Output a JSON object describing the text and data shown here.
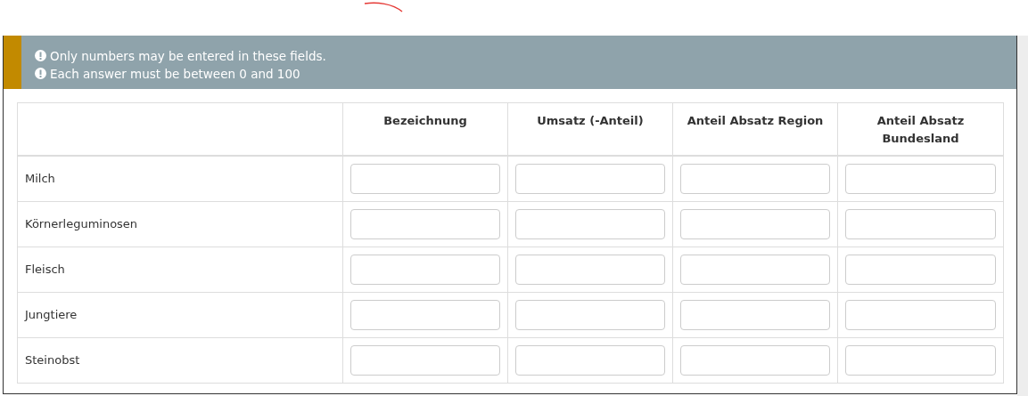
{
  "notices": [
    "Only numbers may be entered in these fields.",
    "Each answer must be between 0 and 100"
  ],
  "table": {
    "columns": [
      "",
      "Bezeichnung",
      "Umsatz (-Anteil)",
      "Anteil Absatz Region",
      "Anteil Absatz Bundesland"
    ],
    "rows": [
      {
        "label": "Milch"
      },
      {
        "label": "Körnerleguminosen"
      },
      {
        "label": "Fleisch"
      },
      {
        "label": "Jungtiere"
      },
      {
        "label": "Steinobst"
      }
    ]
  }
}
